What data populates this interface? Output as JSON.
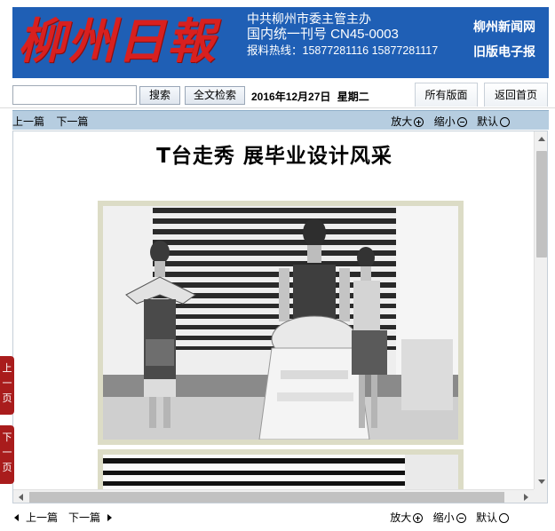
{
  "banner": {
    "logo_text": "柳州日報",
    "info_line1": "中共柳州市委主管主办",
    "info_line2": "国内统一刊号 CN45-0003",
    "info_line3": "报料热线：15877281116  15877281117",
    "link_news": "柳州新闻网",
    "link_old": "旧版电子报"
  },
  "searchbar": {
    "input_value": "",
    "search_label": "搜索",
    "fulltext_label": "全文检索",
    "date": "2016年12月27日",
    "weekday": "星期二",
    "all_pages_label": "所有版面",
    "home_label": "返回首页"
  },
  "toolbar": {
    "prev_article": "上一篇",
    "next_article": "下一篇",
    "zoom_in": "放大",
    "zoom_out": "缩小",
    "default": "默认"
  },
  "article": {
    "title": "T台走秀 展毕业设计风采"
  },
  "side_tabs": {
    "prev_page": "上一页",
    "next_page": "下一页"
  },
  "colors": {
    "banner_blue": "#1f5fb5",
    "logo_red": "#d8201f",
    "side_tab_red": "#a91c1c",
    "toolbar_blue": "#b6cde0"
  }
}
